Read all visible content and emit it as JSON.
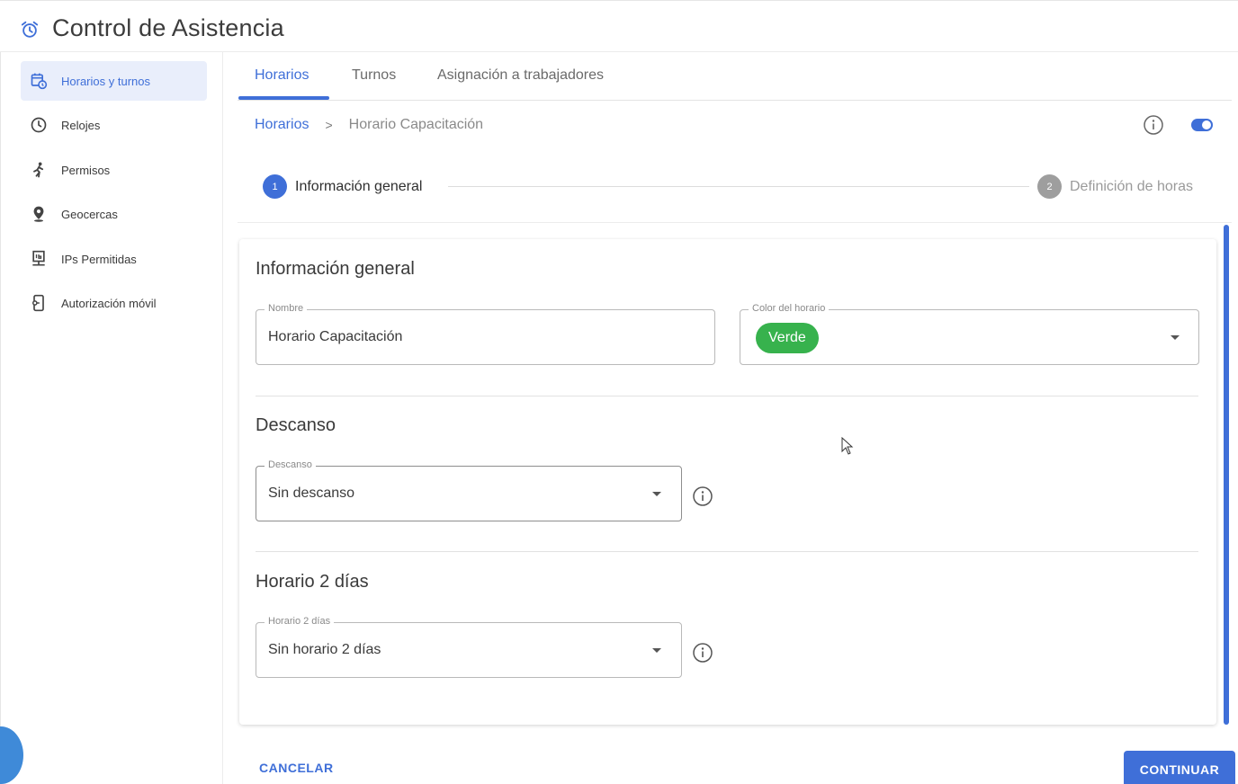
{
  "app": {
    "title": "Control de Asistencia",
    "icon": "alarm-clock-icon"
  },
  "sidebar": {
    "items": [
      {
        "label": "Horarios y turnos",
        "icon": "calendar-clock-icon",
        "active": true
      },
      {
        "label": "Relojes",
        "icon": "clock-icon",
        "active": false
      },
      {
        "label": "Permisos",
        "icon": "running-person-icon",
        "active": false
      },
      {
        "label": "Geocercas",
        "icon": "location-pin-icon",
        "active": false
      },
      {
        "label": "IPs Permitidas",
        "icon": "network-ip-icon",
        "active": false
      },
      {
        "label": "Autorización móvil",
        "icon": "mobile-key-icon",
        "active": false
      }
    ]
  },
  "tabs": [
    {
      "label": "Horarios",
      "active": true
    },
    {
      "label": "Turnos",
      "active": false
    },
    {
      "label": "Asignación a trabajadores",
      "active": false
    }
  ],
  "breadcrumb": {
    "parent": "Horarios",
    "separator": ">",
    "current": "Horario Capacitación"
  },
  "stepper": {
    "steps": [
      {
        "number": "1",
        "label": "Información general",
        "active": true
      },
      {
        "number": "2",
        "label": "Definición de horas",
        "active": false
      }
    ]
  },
  "form": {
    "general": {
      "title": "Información general",
      "name_label": "Nombre",
      "name_value": "Horario Capacitación",
      "color_label": "Color del horario",
      "color_value": "Verde"
    },
    "rest": {
      "title": "Descanso",
      "label": "Descanso",
      "value": "Sin descanso"
    },
    "two_days": {
      "title": "Horario 2 días",
      "label": "Horario 2 días",
      "value": "Sin horario 2 días"
    }
  },
  "actions": {
    "cancel": "CANCELAR",
    "continue": "CONTINUAR"
  },
  "colors": {
    "accent": "#3f6fd8",
    "chip_green": "#37b24d",
    "active_bg": "#e9eefb"
  }
}
